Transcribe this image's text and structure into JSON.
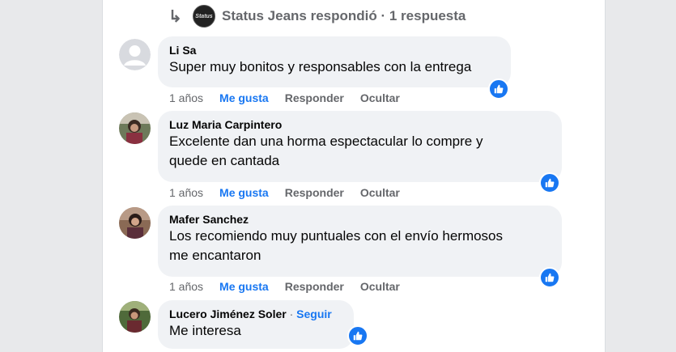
{
  "reply_header": {
    "page_avatar_text": "Status",
    "text": "Status Jeans respondió · 1 respuesta"
  },
  "comments": [
    {
      "author": "Li Sa",
      "text_lines": [
        "Super muy bonitos y responsables con la entrega"
      ],
      "time": "1 años",
      "like_label": "Me gusta",
      "reply_label": "Responder",
      "hide_label": "Ocultar"
    },
    {
      "author": "Luz Maria Carpintero",
      "text_lines": [
        "Excelente dan una horma espectacular lo compre y",
        "quede en cantada"
      ],
      "time": "1 años",
      "like_label": "Me gusta",
      "reply_label": "Responder",
      "hide_label": "Ocultar"
    },
    {
      "author": "Mafer Sanchez",
      "text_lines": [
        "Los recomiendo muy puntuales con el envío hermosos",
        "me encantaron"
      ],
      "time": "1 años",
      "like_label": "Me gusta",
      "reply_label": "Responder",
      "hide_label": "Ocultar"
    },
    {
      "author": "Lucero Jiménez Soler",
      "separator": " · ",
      "follow_label": "Seguir",
      "text_lines": [
        "Me interesa"
      ]
    }
  ],
  "icons": {
    "reply_arrow": "reply-arrow-icon",
    "like_badge": "thumbs-up-icon",
    "default_avatar": "default-user-icon"
  },
  "colors": {
    "accent": "#1877f2",
    "bubble": "#f0f2f5",
    "muted": "#65676b",
    "text": "#050505"
  }
}
